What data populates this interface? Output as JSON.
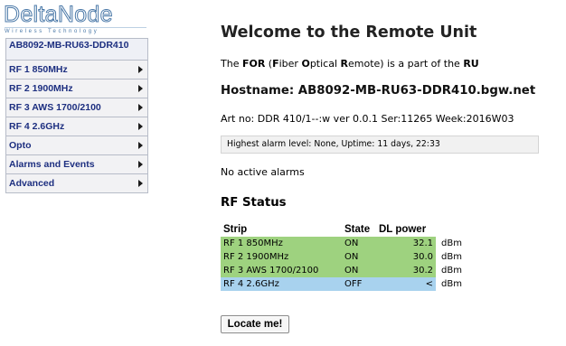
{
  "logo": {
    "name_part1": "Delta",
    "name_part2": "Node",
    "tagline": "Wireless Technology"
  },
  "sidebar": {
    "host": "AB8092-MB-RU63-DDR410",
    "items": [
      {
        "label": "RF 1 850MHz",
        "has_arrow": true
      },
      {
        "label": "RF 2 1900MHz",
        "has_arrow": true
      },
      {
        "label": "RF 3 AWS 1700/2100",
        "has_arrow": true
      },
      {
        "label": "RF 4 2.6GHz",
        "has_arrow": true
      },
      {
        "label": "Opto",
        "has_arrow": true
      },
      {
        "label": "Alarms and Events",
        "has_arrow": true
      },
      {
        "label": "Advanced",
        "has_arrow": true
      }
    ]
  },
  "main": {
    "title": "Welcome to the Remote Unit",
    "intro": {
      "p1": "The ",
      "b1": "FOR",
      "p2": " (",
      "b2": "F",
      "p3": "iber ",
      "b3": "O",
      "p4": "ptical ",
      "b4": "R",
      "p5": "emote) is a part of the ",
      "b5": "RU"
    },
    "hostname": "Hostname: AB8092-MB-RU63-DDR410.bgw.net",
    "artno": "Art no: DDR 410/1--:w ver 0.0.1 Ser:11265 Week:2016W03",
    "alarm_status": "Highest alarm level:  None,    Uptime: 11 days, 22:33",
    "no_alarms": "No active alarms",
    "rf_heading": "RF Status",
    "rf_table": {
      "headers": {
        "strip": "Strip",
        "state": "State",
        "dl_power": "DL power"
      },
      "rows": [
        {
          "strip": "RF 1 850MHz",
          "state": "ON",
          "dl_power": "32.1",
          "unit": "dBm",
          "status_color": "#9ed27f"
        },
        {
          "strip": "RF 2 1900MHz",
          "state": "ON",
          "dl_power": "30.0",
          "unit": "dBm",
          "status_color": "#9ed27f"
        },
        {
          "strip": "RF 3 AWS 1700/2100",
          "state": "ON",
          "dl_power": "30.2",
          "unit": "dBm",
          "status_color": "#9ed27f"
        },
        {
          "strip": "RF 4 2.6GHz",
          "state": "OFF",
          "dl_power": "<",
          "unit": "dBm",
          "status_color": "#a8d2ee"
        }
      ]
    },
    "locate_button": "Locate me!"
  }
}
